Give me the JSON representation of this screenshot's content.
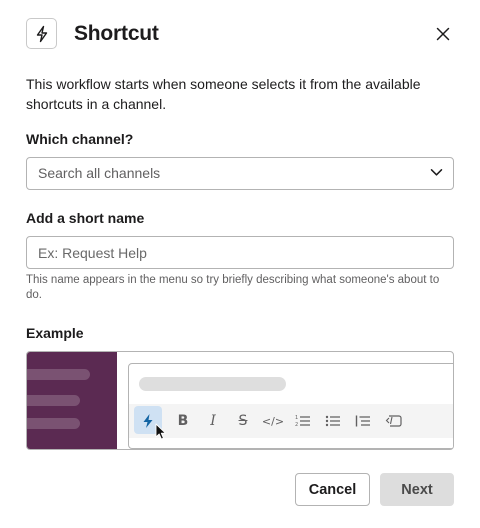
{
  "dialog": {
    "title": "Shortcut",
    "description": "This workflow starts when someone selects it from the available shortcuts in a channel."
  },
  "channel": {
    "label": "Which channel?",
    "placeholder": "Search all channels"
  },
  "short_name": {
    "label": "Add a short name",
    "placeholder": "Ex: Request Help",
    "value": "",
    "hint": "This name appears in the menu so try briefly describing what someone's about to do."
  },
  "example": {
    "label": "Example",
    "toolbar_icons": [
      "shortcut-icon",
      "bold-icon",
      "italic-icon",
      "strikethrough-icon",
      "code-icon",
      "ordered-list-icon",
      "bulleted-list-icon",
      "blockquote-icon",
      "code-block-icon"
    ]
  },
  "footer": {
    "cancel_label": "Cancel",
    "next_label": "Next"
  },
  "colors": {
    "sidebar": "#5b2a52",
    "shortcut_icon": "#1264a3",
    "active_highlight": "#cfe1f3"
  }
}
